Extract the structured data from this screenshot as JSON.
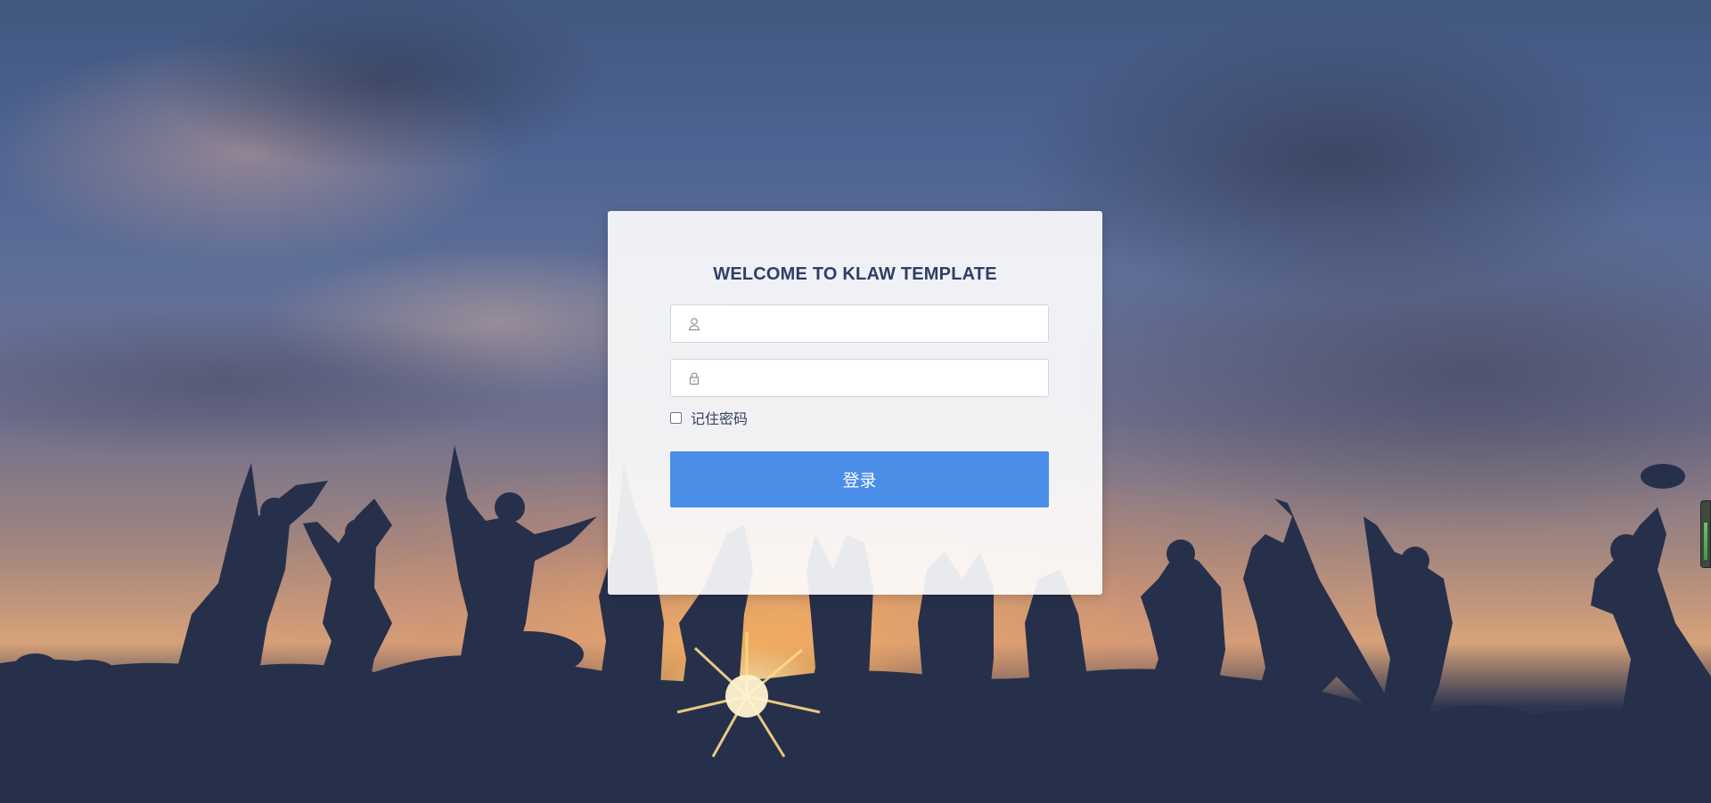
{
  "login": {
    "title": "WELCOME TO KLAW TEMPLATE",
    "username": {
      "value": "",
      "placeholder": "",
      "icon": "user-icon"
    },
    "password": {
      "value": "",
      "placeholder": "",
      "icon": "lock-icon"
    },
    "remember_label": "记住密码",
    "remember_checked": false,
    "submit_label": "登录"
  },
  "colors": {
    "button": "#4a8ee8",
    "title": "#2f3e66",
    "card": "#ffffff"
  }
}
